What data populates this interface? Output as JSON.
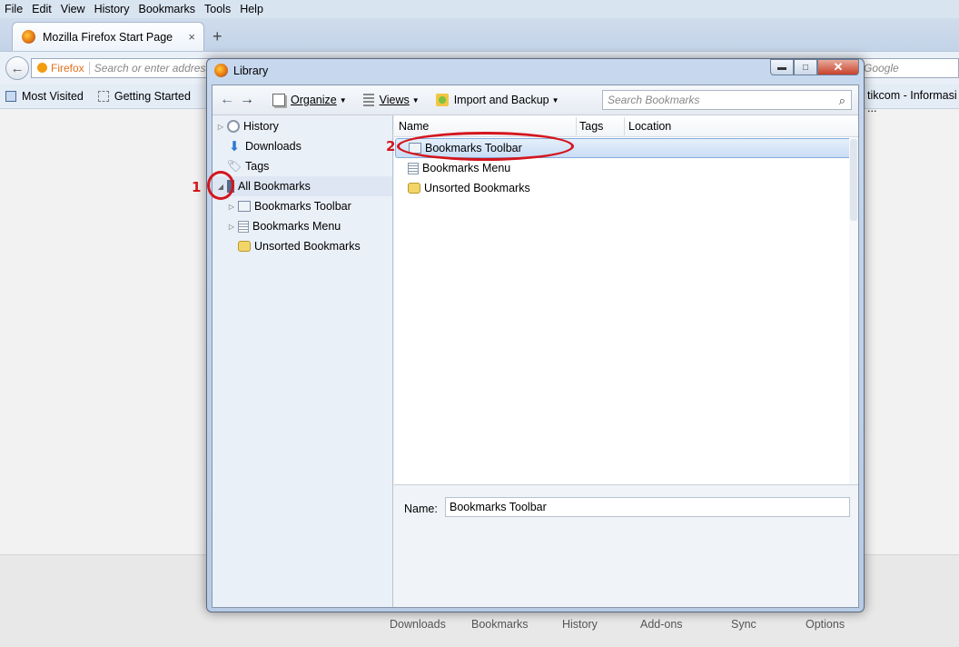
{
  "menubar": {
    "file": "File",
    "edit": "Edit",
    "view": "View",
    "history": "History",
    "bookmarks": "Bookmarks",
    "tools": "Tools",
    "help": "Help"
  },
  "tab": {
    "title": "Mozilla Firefox Start Page",
    "close": "×",
    "new": "+"
  },
  "navbar": {
    "brand": "Firefox",
    "placeholder": "Search or enter address",
    "search_engine": "Google"
  },
  "bookmarks_bar": {
    "items": [
      "Most Visited",
      "Getting Started"
    ],
    "right_item": "tikcom - Informasi ..."
  },
  "launcher": {
    "items": [
      "Downloads",
      "Bookmarks",
      "History",
      "Add-ons",
      "Sync",
      "Options"
    ]
  },
  "library": {
    "title": "Library",
    "buttons": {
      "minimize": "▬",
      "maximize": "□",
      "close": "✕"
    },
    "toolbar": {
      "organize": "Organize",
      "views": "Views",
      "import_backup": "Import and Backup",
      "search_placeholder": "Search Bookmarks"
    },
    "sidebar": {
      "history": "History",
      "downloads": "Downloads",
      "tags": "Tags",
      "all_bookmarks": "All Bookmarks",
      "children": [
        "Bookmarks Toolbar",
        "Bookmarks Menu",
        "Unsorted Bookmarks"
      ]
    },
    "columns": {
      "name": "Name",
      "tags": "Tags",
      "location": "Location"
    },
    "rows": [
      "Bookmarks Toolbar",
      "Bookmarks Menu",
      "Unsorted Bookmarks"
    ],
    "detail": {
      "name_label": "Name:",
      "name_value": "Bookmarks Toolbar"
    }
  },
  "annotations": {
    "step1": "1",
    "step2": "2",
    "color": "#d4161e"
  }
}
